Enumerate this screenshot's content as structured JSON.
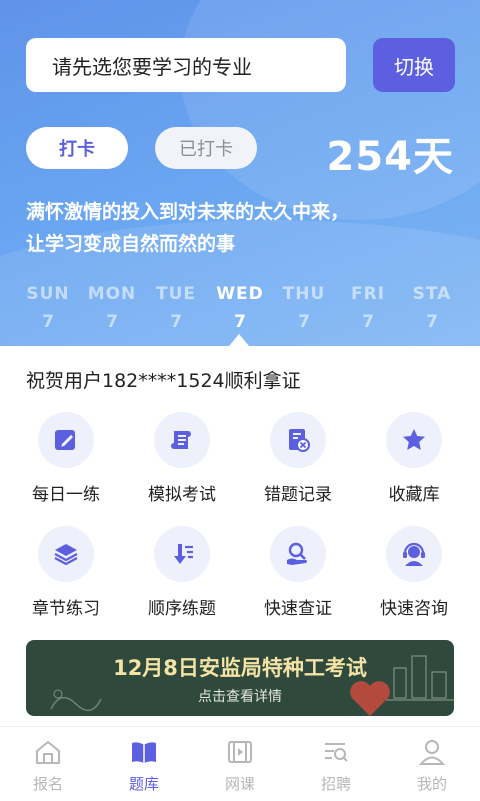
{
  "header": {
    "search_placeholder": "请先选您要学习的专业",
    "switch_label": "切换",
    "checkin_label": "打卡",
    "checked_label": "已打卡",
    "days": "254天",
    "motto_line1": "满怀激情的投入到对未来的太久中来，",
    "motto_line2": "让学习变成自然而然的事"
  },
  "week": [
    {
      "name": "SUN",
      "value": "7"
    },
    {
      "name": "MON",
      "value": "7"
    },
    {
      "name": "TUE",
      "value": "7"
    },
    {
      "name": "WED",
      "value": "7"
    },
    {
      "name": "THU",
      "value": "7"
    },
    {
      "name": "FRI",
      "value": "7"
    },
    {
      "name": "STA",
      "value": "7"
    }
  ],
  "congrats": "祝贺用户182****1524顺利拿证",
  "features": [
    {
      "label": "每日一练",
      "icon": "pencil-icon"
    },
    {
      "label": "模拟考试",
      "icon": "scroll-icon"
    },
    {
      "label": "错题记录",
      "icon": "error-doc-icon"
    },
    {
      "label": "收藏库",
      "icon": "star-icon"
    },
    {
      "label": "章节练习",
      "icon": "layers-icon"
    },
    {
      "label": "顺序练题",
      "icon": "list-order-icon"
    },
    {
      "label": "快速查证",
      "icon": "search-hand-icon"
    },
    {
      "label": "快速咨询",
      "icon": "headset-icon"
    }
  ],
  "banner": {
    "title": "12月8日安监局特种工考试",
    "subtitle": "点击查看详情"
  },
  "tabs": [
    {
      "label": "报名",
      "icon": "home-icon"
    },
    {
      "label": "题库",
      "icon": "book-icon"
    },
    {
      "label": "网课",
      "icon": "video-icon"
    },
    {
      "label": "招聘",
      "icon": "search-list-icon"
    },
    {
      "label": "我的",
      "icon": "user-icon"
    }
  ],
  "colors": {
    "accent": "#5b5fe0",
    "hero": "#6aa6f1",
    "banner_bg": "#2f4a3c",
    "banner_title": "#f4e3a5"
  }
}
